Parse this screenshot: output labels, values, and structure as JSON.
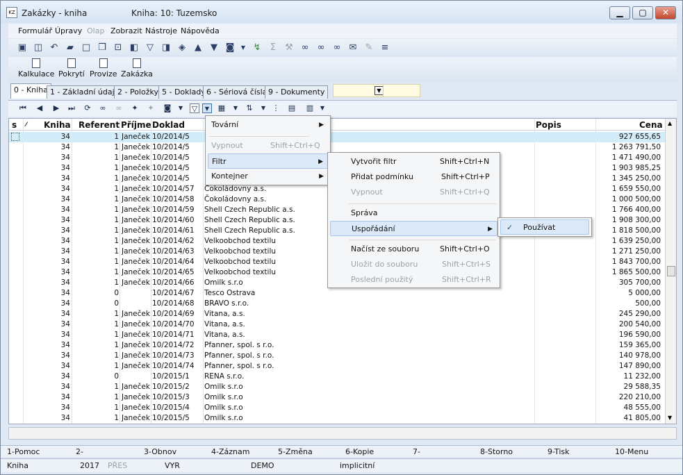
{
  "window": {
    "title": "Zakázky - kniha",
    "book": "Kniha: 10: Tuzemsko",
    "minimize": "▁",
    "maximize": "▢",
    "close": "✕"
  },
  "menu": [
    "Formulář",
    "Úpravy",
    "Olap",
    "Zobrazit",
    "Nástroje",
    "Nápověda"
  ],
  "toolbar_big": [
    "Kalkulace",
    "Pokrytí",
    "Provize",
    "Zakázka"
  ],
  "tabs": [
    "0 - Kniha",
    "1 - Základní údaje",
    "2 - Položky",
    "5 - Doklady",
    "6 - Sériová čísla",
    "9 - Dokumenty"
  ],
  "grid": {
    "headers": {
      "s": "s",
      "sort": "⁄",
      "kniha": "Kniha",
      "referent": "Referent",
      "prijmeni": "Příjmení",
      "doklad": "Doklad",
      "nazev": "",
      "popis": "Popis",
      "cena": "Cena"
    },
    "rows": [
      {
        "k": "34",
        "r": "1",
        "p": "Janeček",
        "d": "10/2014/5",
        "n": "",
        "c": "927 655,65"
      },
      {
        "k": "34",
        "r": "1",
        "p": "Janeček",
        "d": "10/2014/5",
        "n": "",
        "c": "1 263 791,50"
      },
      {
        "k": "34",
        "r": "1",
        "p": "Janeček",
        "d": "10/2014/5",
        "n": "",
        "c": "1 471 490,00"
      },
      {
        "k": "34",
        "r": "1",
        "p": "Janeček",
        "d": "10/2014/5",
        "n": "",
        "c": "1 903 985,25"
      },
      {
        "k": "34",
        "r": "1",
        "p": "Janeček",
        "d": "10/2014/5",
        "n": "",
        "c": "1 345 250,00"
      },
      {
        "k": "34",
        "r": "1",
        "p": "Janeček",
        "d": "10/2014/57",
        "n": "Čokoládovny a.s.",
        "c": "1 659 550,00"
      },
      {
        "k": "34",
        "r": "1",
        "p": "Janeček",
        "d": "10/2014/58",
        "n": "Čokoládovny a.s.",
        "c": "1 000 500,00"
      },
      {
        "k": "34",
        "r": "1",
        "p": "Janeček",
        "d": "10/2014/59",
        "n": "Shell Czech Republic a.s.",
        "c": "1 766 400,00"
      },
      {
        "k": "34",
        "r": "1",
        "p": "Janeček",
        "d": "10/2014/60",
        "n": "Shell Czech Republic a.s.",
        "c": "1 908 300,00"
      },
      {
        "k": "34",
        "r": "1",
        "p": "Janeček",
        "d": "10/2014/61",
        "n": "Shell Czech Republic a.s.",
        "c": "1 818 500,00"
      },
      {
        "k": "34",
        "r": "1",
        "p": "Janeček",
        "d": "10/2014/62",
        "n": "Velkoobchod textilu",
        "c": "1 639 250,00"
      },
      {
        "k": "34",
        "r": "1",
        "p": "Janeček",
        "d": "10/2014/63",
        "n": "Velkoobchod textilu",
        "c": "1 271 250,00"
      },
      {
        "k": "34",
        "r": "1",
        "p": "Janeček",
        "d": "10/2014/64",
        "n": "Velkoobchod textilu",
        "c": "1 843 700,00"
      },
      {
        "k": "34",
        "r": "1",
        "p": "Janeček",
        "d": "10/2014/65",
        "n": "Velkoobchod textilu",
        "c": "1 865 500,00"
      },
      {
        "k": "34",
        "r": "1",
        "p": "Janeček",
        "d": "10/2014/66",
        "n": "Omilk s.r.o",
        "c": "305 700,00"
      },
      {
        "k": "34",
        "r": "0",
        "p": "",
        "d": "10/2014/67",
        "n": "Tesco Ostrava",
        "c": "5 000,00"
      },
      {
        "k": "34",
        "r": "0",
        "p": "",
        "d": "10/2014/68",
        "n": "BRAVO s.r.o.",
        "c": "500,00"
      },
      {
        "k": "34",
        "r": "1",
        "p": "Janeček",
        "d": "10/2014/69",
        "n": "Vitana, a.s.",
        "c": "245 290,00"
      },
      {
        "k": "34",
        "r": "1",
        "p": "Janeček",
        "d": "10/2014/70",
        "n": "Vitana, a.s.",
        "c": "200 540,00"
      },
      {
        "k": "34",
        "r": "1",
        "p": "Janeček",
        "d": "10/2014/71",
        "n": "Vitana, a.s.",
        "c": "196 590,00"
      },
      {
        "k": "34",
        "r": "1",
        "p": "Janeček",
        "d": "10/2014/72",
        "n": "Pfanner, spol. s r.o.",
        "c": "159 365,00"
      },
      {
        "k": "34",
        "r": "1",
        "p": "Janeček",
        "d": "10/2014/73",
        "n": "Pfanner, spol. s r.o.",
        "c": "140 978,00"
      },
      {
        "k": "34",
        "r": "1",
        "p": "Janeček",
        "d": "10/2014/74",
        "n": "Pfanner, spol. s r.o.",
        "c": "147 890,00"
      },
      {
        "k": "34",
        "r": "0",
        "p": "",
        "d": "10/2015/1",
        "n": "RENA s.r.o.",
        "c": "11 232,00"
      },
      {
        "k": "34",
        "r": "1",
        "p": "Janeček",
        "d": "10/2015/2",
        "n": "Omilk s.r.o",
        "c": "29 588,35"
      },
      {
        "k": "34",
        "r": "1",
        "p": "Janeček",
        "d": "10/2015/3",
        "n": "Omilk s.r.o",
        "c": "220 210,00"
      },
      {
        "k": "34",
        "r": "1",
        "p": "Janeček",
        "d": "10/2015/4",
        "n": "Omilk s.r.o",
        "c": "48 555,00"
      },
      {
        "k": "34",
        "r": "1",
        "p": "Janeček",
        "d": "10/2015/5",
        "n": "Omilk s.r.o",
        "c": "41 805,00"
      }
    ]
  },
  "fkeys": [
    "1-Pomoc",
    "2-",
    "3-Obnov",
    "4-Záznam",
    "5-Změna",
    "6-Kopie",
    "7-",
    "8-Storno",
    "9-Tisk",
    "10-Menu"
  ],
  "status": {
    "kniha": "Kniha",
    "rok": "2017",
    "pres": "PŘES",
    "vyr": "VYR",
    "demo": "DEMO",
    "implicitni": "implicitní"
  },
  "menu1": [
    {
      "label": "Tovární",
      "shortcut": "",
      "submenu": true,
      "disabled": false
    },
    {
      "label": "Vypnout",
      "shortcut": "Shift+Ctrl+Q",
      "submenu": false,
      "disabled": true
    },
    {
      "label": "Filtr",
      "shortcut": "",
      "submenu": true,
      "disabled": false
    },
    {
      "label": "Kontejner",
      "shortcut": "",
      "submenu": true,
      "disabled": false
    }
  ],
  "menu2": [
    {
      "label": "Vytvořit filtr",
      "shortcut": "Shift+Ctrl+N"
    },
    {
      "label": "Přidat podmínku",
      "shortcut": "Shift+Ctrl+P"
    },
    {
      "label": "Vypnout",
      "shortcut": "Shift+Ctrl+Q"
    },
    {
      "label": "Správa",
      "shortcut": ""
    },
    {
      "label": "Uspořádání",
      "shortcut": ""
    },
    {
      "label": "Načíst ze souboru",
      "shortcut": "Shift+Ctrl+O"
    },
    {
      "label": "Uložit do souboru",
      "shortcut": "Shift+Ctrl+S"
    },
    {
      "label": "Poslední použitý",
      "shortcut": "Shift+Ctrl+R"
    }
  ],
  "menu3": {
    "label": "Používat",
    "check": "✓"
  }
}
